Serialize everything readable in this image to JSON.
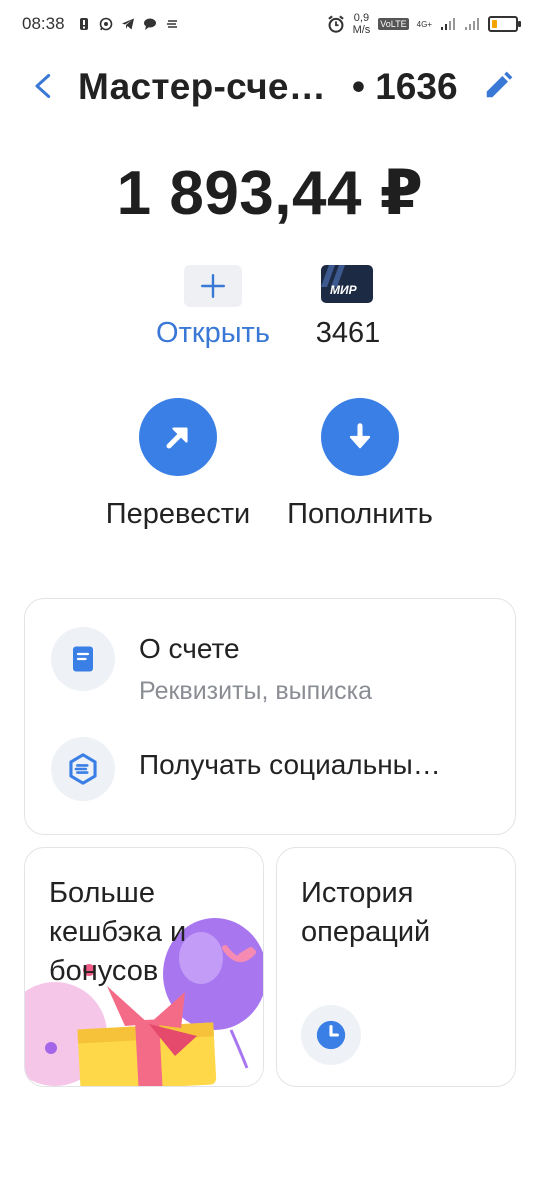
{
  "status_bar": {
    "time": "08:38",
    "net_speed_value": "0,9",
    "net_speed_unit": "M/s",
    "volte": "VoLTE",
    "network": "4G+"
  },
  "header": {
    "title": "Мастер-сче…",
    "account_suffix": "• 1636"
  },
  "balance": "1 893,44 ₽",
  "open_card": {
    "label": "Открыть"
  },
  "card": {
    "brand": "МИР",
    "number": "3461"
  },
  "actions": {
    "transfer_label": "Перевести",
    "topup_label": "Пополнить"
  },
  "account_menu": {
    "about_title": "О счете",
    "about_subtitle": "Реквизиты, выписка",
    "social_title": "Получать социальны…"
  },
  "tiles": {
    "cashback_title_line1": "Больше",
    "cashback_title_line2": "кешбэка и",
    "cashback_title_line3": "бонусов",
    "history_title_line1": "История",
    "history_title_line2": "операций"
  },
  "colors": {
    "accent": "#3a7fe6",
    "link": "#3a78d6",
    "icon_bg": "#eef1f6",
    "mir_card": "#1d2a44"
  },
  "battery_level": 0.2
}
